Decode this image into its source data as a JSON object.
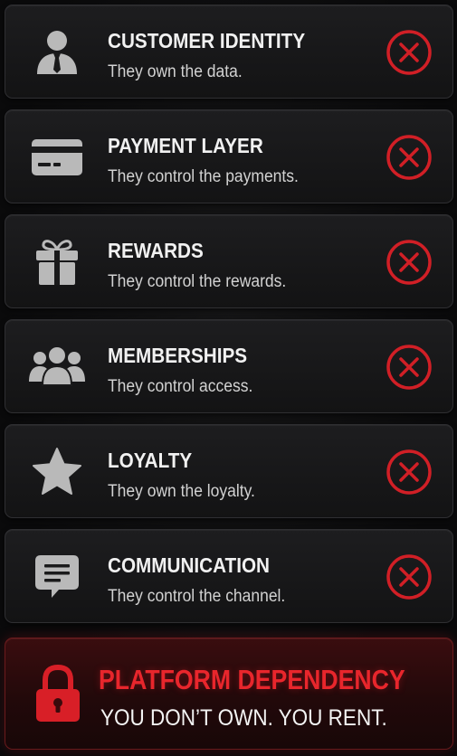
{
  "items": [
    {
      "title": "CUSTOMER IDENTITY",
      "subtitle": "They own the data.",
      "icon": "user-tie-icon",
      "status_icon": "x-circle-icon"
    },
    {
      "title": "PAYMENT LAYER",
      "subtitle": "They control the payments.",
      "icon": "credit-card-icon",
      "status_icon": "x-circle-icon"
    },
    {
      "title": "REWARDS",
      "subtitle": "They control the rewards.",
      "icon": "gift-icon",
      "status_icon": "x-circle-icon"
    },
    {
      "title": "MEMBERSHIPS",
      "subtitle": "They control access.",
      "icon": "group-icon",
      "status_icon": "x-circle-icon"
    },
    {
      "title": "LOYALTY",
      "subtitle": "They own the loyalty.",
      "icon": "star-icon",
      "status_icon": "x-circle-icon"
    },
    {
      "title": "COMMUNICATION",
      "subtitle": "They control the channel.",
      "icon": "chat-bubble-icon",
      "status_icon": "x-circle-icon"
    }
  ],
  "banner": {
    "title": "PLATFORM DEPENDENCY",
    "subtitle": "YOU DON’T OWN. YOU RENT.",
    "icon": "lock-icon"
  },
  "colors": {
    "accent_red": "#e8262c",
    "icon_gray": "#b9b9b9",
    "card_bg": "#18181a",
    "page_bg": "#0b0b0c"
  }
}
